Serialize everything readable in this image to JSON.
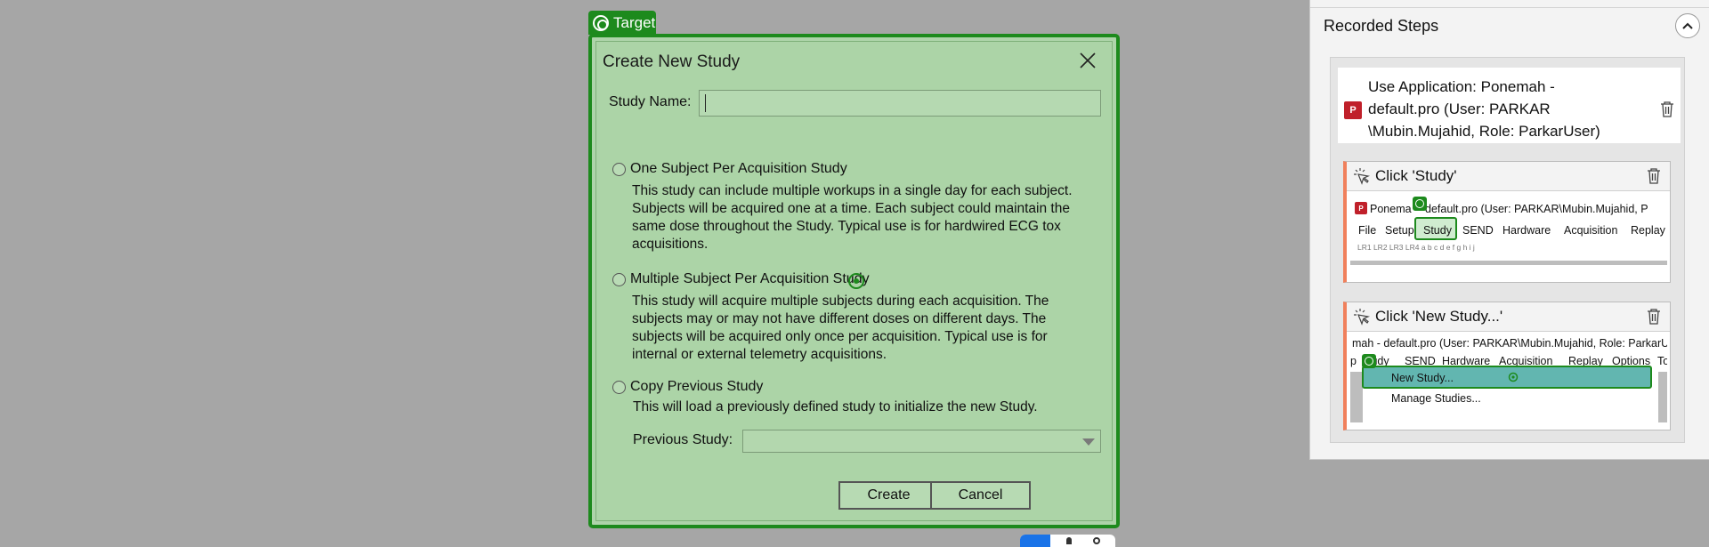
{
  "target": {
    "label": "Target"
  },
  "dialog": {
    "title": "Create New Study",
    "study_name_label": "Study Name:",
    "study_name_value": "",
    "options": [
      {
        "title": "One Subject Per Acquisition Study",
        "description_lines": [
          "This study can include multiple workups in a single day for each subject.",
          "Subjects will be acquired one at a time. Each subject could maintain the",
          "same dose throughout the Study. Typical use is for hardwired ECG tox",
          "acquisitions."
        ]
      },
      {
        "title": "Multiple Subject Per Acquisition Study",
        "description_lines": [
          "This study will acquire multiple subjects during each acquisition. The",
          "subjects may or may not have different doses on different days. The",
          "subjects will be acquired only once per acquisition. Typical use is for",
          "internal or external telemetry acquisitions."
        ]
      },
      {
        "title": "Copy Previous Study",
        "description_lines": [
          "This will load a previously defined study to initialize the new Study."
        ]
      }
    ],
    "previous_study_label": "Previous Study:",
    "previous_study_value": "",
    "create_label": "Create",
    "cancel_label": "Cancel"
  },
  "panel": {
    "title": "Recorded Steps",
    "app_step": {
      "logo_text": "P",
      "lines": [
        "Use Application: Ponemah -",
        "default.pro (User: PARKAR",
        "\\Mubin.Mujahid, Role: ParkarUser)"
      ]
    },
    "steps": [
      {
        "title": "Click 'Study'",
        "thumb_title": "Ponema",
        "thumb_title_rest": "default.pro (User: PARKAR\\Mubin.Mujahid, P",
        "menu": [
          "File",
          "Setup",
          "Study",
          "SEND",
          "Hardware",
          "Acquisition",
          "Replay"
        ],
        "toolbar_text": "LR1 LR2 LR3 LR4   a   b   c   d   e   f   g   h   i   j"
      },
      {
        "title": "Click 'New Study...'",
        "thumb_title": "mah - default.pro (User: PARKAR\\Mubin.Mujahid, Role: ParkarUs",
        "menu": [
          "tudy",
          "SEND",
          "Hardware",
          "Acquisition",
          "Replay",
          "Options",
          "To"
        ],
        "menu_prefix": "p",
        "items": [
          "New Study...",
          "Manage Studies..."
        ]
      }
    ]
  },
  "colors": {
    "accent_green": "#1d8a1d",
    "dialog_bg": "#acd4a7",
    "step_accent": "#f0805c",
    "logo_red": "#c0202a"
  }
}
